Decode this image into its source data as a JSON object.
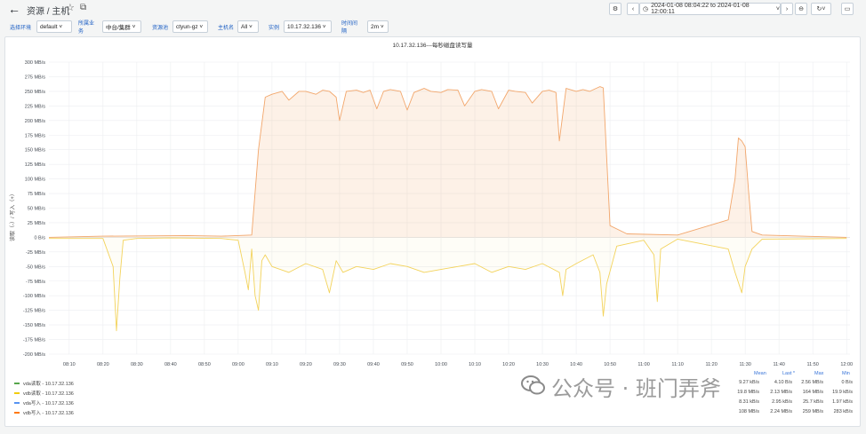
{
  "header": {
    "title": "资源 / 主机",
    "time_range": "2024-01-08 08:04:22 to 2024-01-08 12:00:11"
  },
  "filters": [
    {
      "label": "选择环境",
      "value": "default"
    },
    {
      "label": "所属业务",
      "value": "中台/集群"
    },
    {
      "label": "资源池",
      "value": "ctyun-gz"
    },
    {
      "label": "主机名",
      "value": "All"
    },
    {
      "label": "实例",
      "value": "10.17.32.136"
    },
    {
      "label": "时间间隔",
      "value": "2m"
    }
  ],
  "panel": {
    "title": "10.17.32.136---每秒磁盘读写量",
    "ylabel": "读取（-）/ 写入（+）"
  },
  "chart_data": {
    "type": "area",
    "title": "10.17.32.136---每秒磁盘读写量",
    "ylabel": "读取（-）/ 写入（+）",
    "ylim": [
      -200,
      300
    ],
    "yunit": "MB/s",
    "y_ticks": [
      "300 MB/s",
      "275 MB/s",
      "250 MB/s",
      "225 MB/s",
      "200 MB/s",
      "175 MB/s",
      "150 MB/s",
      "125 MB/s",
      "100 MB/s",
      "75 MB/s",
      "50 MB/s",
      "25 MB/s",
      "0 B/s",
      "-25 MB/s",
      "-50 MB/s",
      "-75 MB/s",
      "-100 MB/s",
      "-125 MB/s",
      "-150 MB/s",
      "-175 MB/s",
      "-200 MB/s"
    ],
    "x_ticks": [
      "08:10",
      "08:20",
      "08:30",
      "08:40",
      "08:50",
      "09:00",
      "09:10",
      "09:20",
      "09:30",
      "09:40",
      "09:50",
      "10:00",
      "10:10",
      "10:20",
      "10:30",
      "10:40",
      "10:50",
      "11:00",
      "11:10",
      "11:20",
      "11:30",
      "11:40",
      "11:50",
      "12:00"
    ],
    "grid": true,
    "series": [
      {
        "name": "vdb写入 - 10.17.32.136",
        "color": "#f2a66b",
        "x": [
          "08:04",
          "08:20",
          "08:45",
          "08:55",
          "09:04",
          "09:06",
          "09:08",
          "09:10",
          "09:13",
          "09:15",
          "09:18",
          "09:20",
          "09:23",
          "09:25",
          "09:27",
          "09:29",
          "09:30",
          "09:32",
          "09:35",
          "09:37",
          "09:39",
          "09:41",
          "09:43",
          "09:45",
          "09:48",
          "09:50",
          "09:52",
          "09:55",
          "09:57",
          "10:00",
          "10:02",
          "10:05",
          "10:07",
          "10:10",
          "10:12",
          "10:15",
          "10:17",
          "10:20",
          "10:22",
          "10:25",
          "10:27",
          "10:30",
          "10:32",
          "10:34",
          "10:35",
          "10:37",
          "10:40",
          "10:42",
          "10:44",
          "10:47",
          "10:48",
          "10:50",
          "10:55",
          "11:10",
          "11:25",
          "11:27",
          "11:28",
          "11:29",
          "11:30",
          "11:31",
          "11:32",
          "11:35",
          "12:00"
        ],
        "values": [
          0,
          2,
          3,
          2,
          4,
          150,
          240,
          245,
          250,
          235,
          250,
          250,
          245,
          252,
          250,
          240,
          200,
          250,
          252,
          248,
          252,
          220,
          250,
          253,
          250,
          218,
          248,
          255,
          250,
          248,
          253,
          252,
          225,
          250,
          253,
          250,
          220,
          252,
          250,
          248,
          230,
          250,
          252,
          248,
          165,
          255,
          250,
          253,
          250,
          258,
          256,
          20,
          6,
          4,
          30,
          100,
          170,
          165,
          155,
          80,
          10,
          4,
          0
        ]
      },
      {
        "name": "vdb读取 - 10.17.32.136",
        "color": "#f3d35c",
        "x": [
          "08:04",
          "08:20",
          "08:23",
          "08:24",
          "08:25",
          "08:26",
          "08:30",
          "08:40",
          "08:55",
          "09:00",
          "09:02",
          "09:03",
          "09:04",
          "09:05",
          "09:06",
          "09:07",
          "09:08",
          "09:10",
          "09:15",
          "09:20",
          "09:25",
          "09:27",
          "09:29",
          "09:31",
          "09:35",
          "09:40",
          "09:45",
          "09:50",
          "09:55",
          "10:00",
          "10:05",
          "10:10",
          "10:15",
          "10:20",
          "10:25",
          "10:30",
          "10:35",
          "10:36",
          "10:37",
          "10:40",
          "10:45",
          "10:47",
          "10:48",
          "10:49",
          "10:52",
          "11:00",
          "11:03",
          "11:04",
          "11:05",
          "11:10",
          "11:25",
          "11:27",
          "11:29",
          "11:30",
          "11:32",
          "11:35",
          "12:00"
        ],
        "values": [
          -2,
          -2,
          -50,
          -160,
          -70,
          -5,
          -2,
          -1,
          -2,
          -5,
          -60,
          -90,
          -20,
          -100,
          -125,
          -40,
          -30,
          -50,
          -60,
          -45,
          -55,
          -95,
          -40,
          -60,
          -50,
          -55,
          -45,
          -50,
          -60,
          -55,
          -50,
          -45,
          -60,
          -50,
          -55,
          -45,
          -60,
          -100,
          -55,
          -45,
          -30,
          -60,
          -135,
          -80,
          -15,
          -5,
          -30,
          -110,
          -20,
          -3,
          -20,
          -60,
          -95,
          -50,
          -20,
          -3,
          -2
        ]
      }
    ],
    "legend_headers": [
      "Mean",
      "Last *",
      "Max",
      "Min"
    ],
    "legend": [
      {
        "name": "vda读取 - 10.17.32.136",
        "color": "#56a64b",
        "mean": "9.27 kB/s",
        "last": "4.10 B/s",
        "max": "2.56 MB/s",
        "min": "0 B/s"
      },
      {
        "name": "vdb读取 - 10.17.32.136",
        "color": "#f2cc0c",
        "mean": "19.8 MB/s",
        "last": "2.13 MB/s",
        "max": "164 MB/s",
        "min": "19.9 kB/s"
      },
      {
        "name": "vda写入 - 10.17.32.136",
        "color": "#5794f2",
        "mean": "8.31 kB/s",
        "last": "2.95 kB/s",
        "max": "25.7 kB/s",
        "min": "1.97 kB/s"
      },
      {
        "name": "vdb写入 - 10.17.32.136",
        "color": "#ff780a",
        "mean": "108 MB/s",
        "last": "2.24 MB/s",
        "max": "259 MB/s",
        "min": "283 kB/s"
      }
    ]
  },
  "watermark": "公众号 · 班门弄斧"
}
